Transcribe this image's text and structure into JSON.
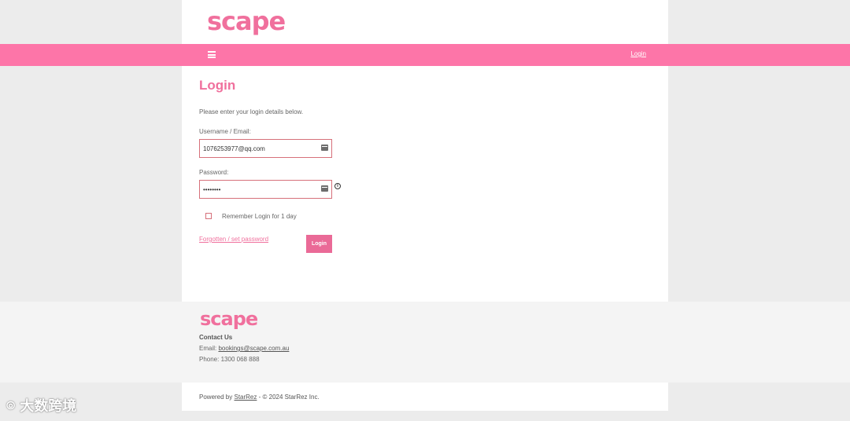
{
  "brand": {
    "logo": "scape",
    "accent": "#f0709d",
    "nav_color": "#fd75a8",
    "button_color": "#ea6a97"
  },
  "nav": {
    "login_link": "Login",
    "menu_icon": "hamburger-icon"
  },
  "main": {
    "title": "Login",
    "intro": "Please enter your login details below.",
    "username_label": "Username / Email:",
    "username_value": "1076253977@qq.com",
    "password_label": "Password:",
    "password_value": "••••••••",
    "remember_label": "Remember Login for 1 day",
    "remember_checked": false,
    "forgot_link": "Forgotten / set password",
    "login_button": "Login",
    "field_icon": "credit-card-icon",
    "info_icon": "info-icon"
  },
  "footer": {
    "logo": "scape",
    "contact_heading": "Contact Us",
    "email_label": "Email:",
    "email_value": "bookings@scape.com.au",
    "phone_label": "Phone:",
    "phone_value": "1300 068 888",
    "powered_prefix": "Powered by",
    "powered_link": "StarRez",
    "powered_suffix": "- © 2024 StarRez Inc."
  },
  "watermark": {
    "text": "大数跨境"
  }
}
